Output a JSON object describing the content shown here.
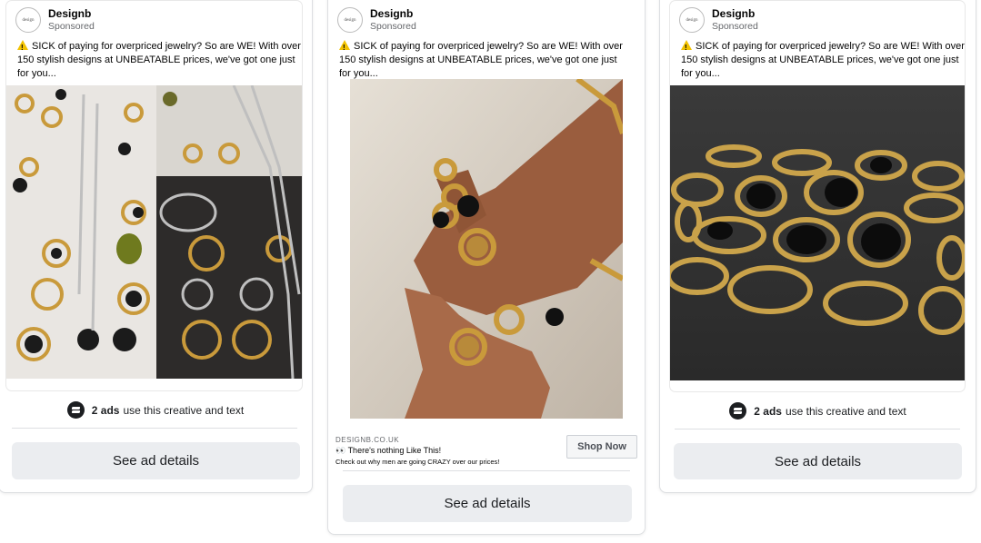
{
  "advertiser": {
    "name": "Designb",
    "sponsored": "Sponsored",
    "avatar_text": "design"
  },
  "ad_text": "SICK of paying for overpriced jewelry? So are WE! With over 150 stylish designs at UNBEATABLE prices, we've got one just for you...",
  "warning_icon": "warning-icon",
  "cards": [
    {
      "ads_count": "2 ads",
      "ads_suffix": "use this creative and text",
      "button": "See ad details"
    },
    {
      "link_domain": "DESIGNB.CO.UK",
      "link_title": "There's nothing Like This!",
      "link_desc": "Check out why men are going CRAZY over our prices!",
      "cta": "Shop Now",
      "button": "See ad details"
    },
    {
      "ads_count": "2 ads",
      "ads_suffix": "use this creative and text",
      "button": "See ad details"
    }
  ],
  "colors": {
    "button_bg": "#ebedf0",
    "text": "#1c1e21",
    "muted": "#65676b",
    "border": "#dddfe2"
  }
}
